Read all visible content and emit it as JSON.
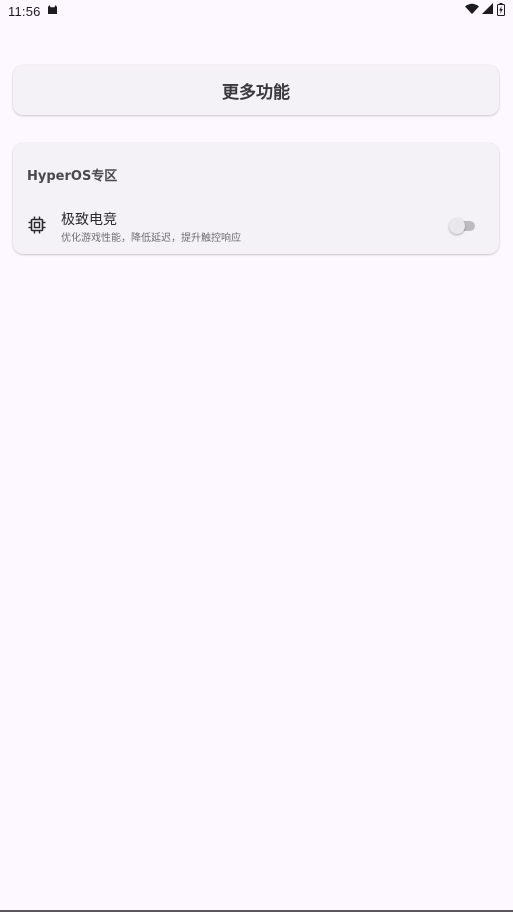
{
  "status_bar": {
    "time": "11:56"
  },
  "header": {
    "title": "更多功能"
  },
  "section": {
    "title": "HyperOS专区",
    "items": [
      {
        "title": "极致电竞",
        "subtitle": "优化游戏性能，降低延迟，提升触控响应",
        "icon": "cpu-chip-icon",
        "enabled": false
      }
    ]
  },
  "colors": {
    "background": "#fdf7ff",
    "card": "#f4f2f7",
    "toggle_off_track": "#bdbac1"
  }
}
